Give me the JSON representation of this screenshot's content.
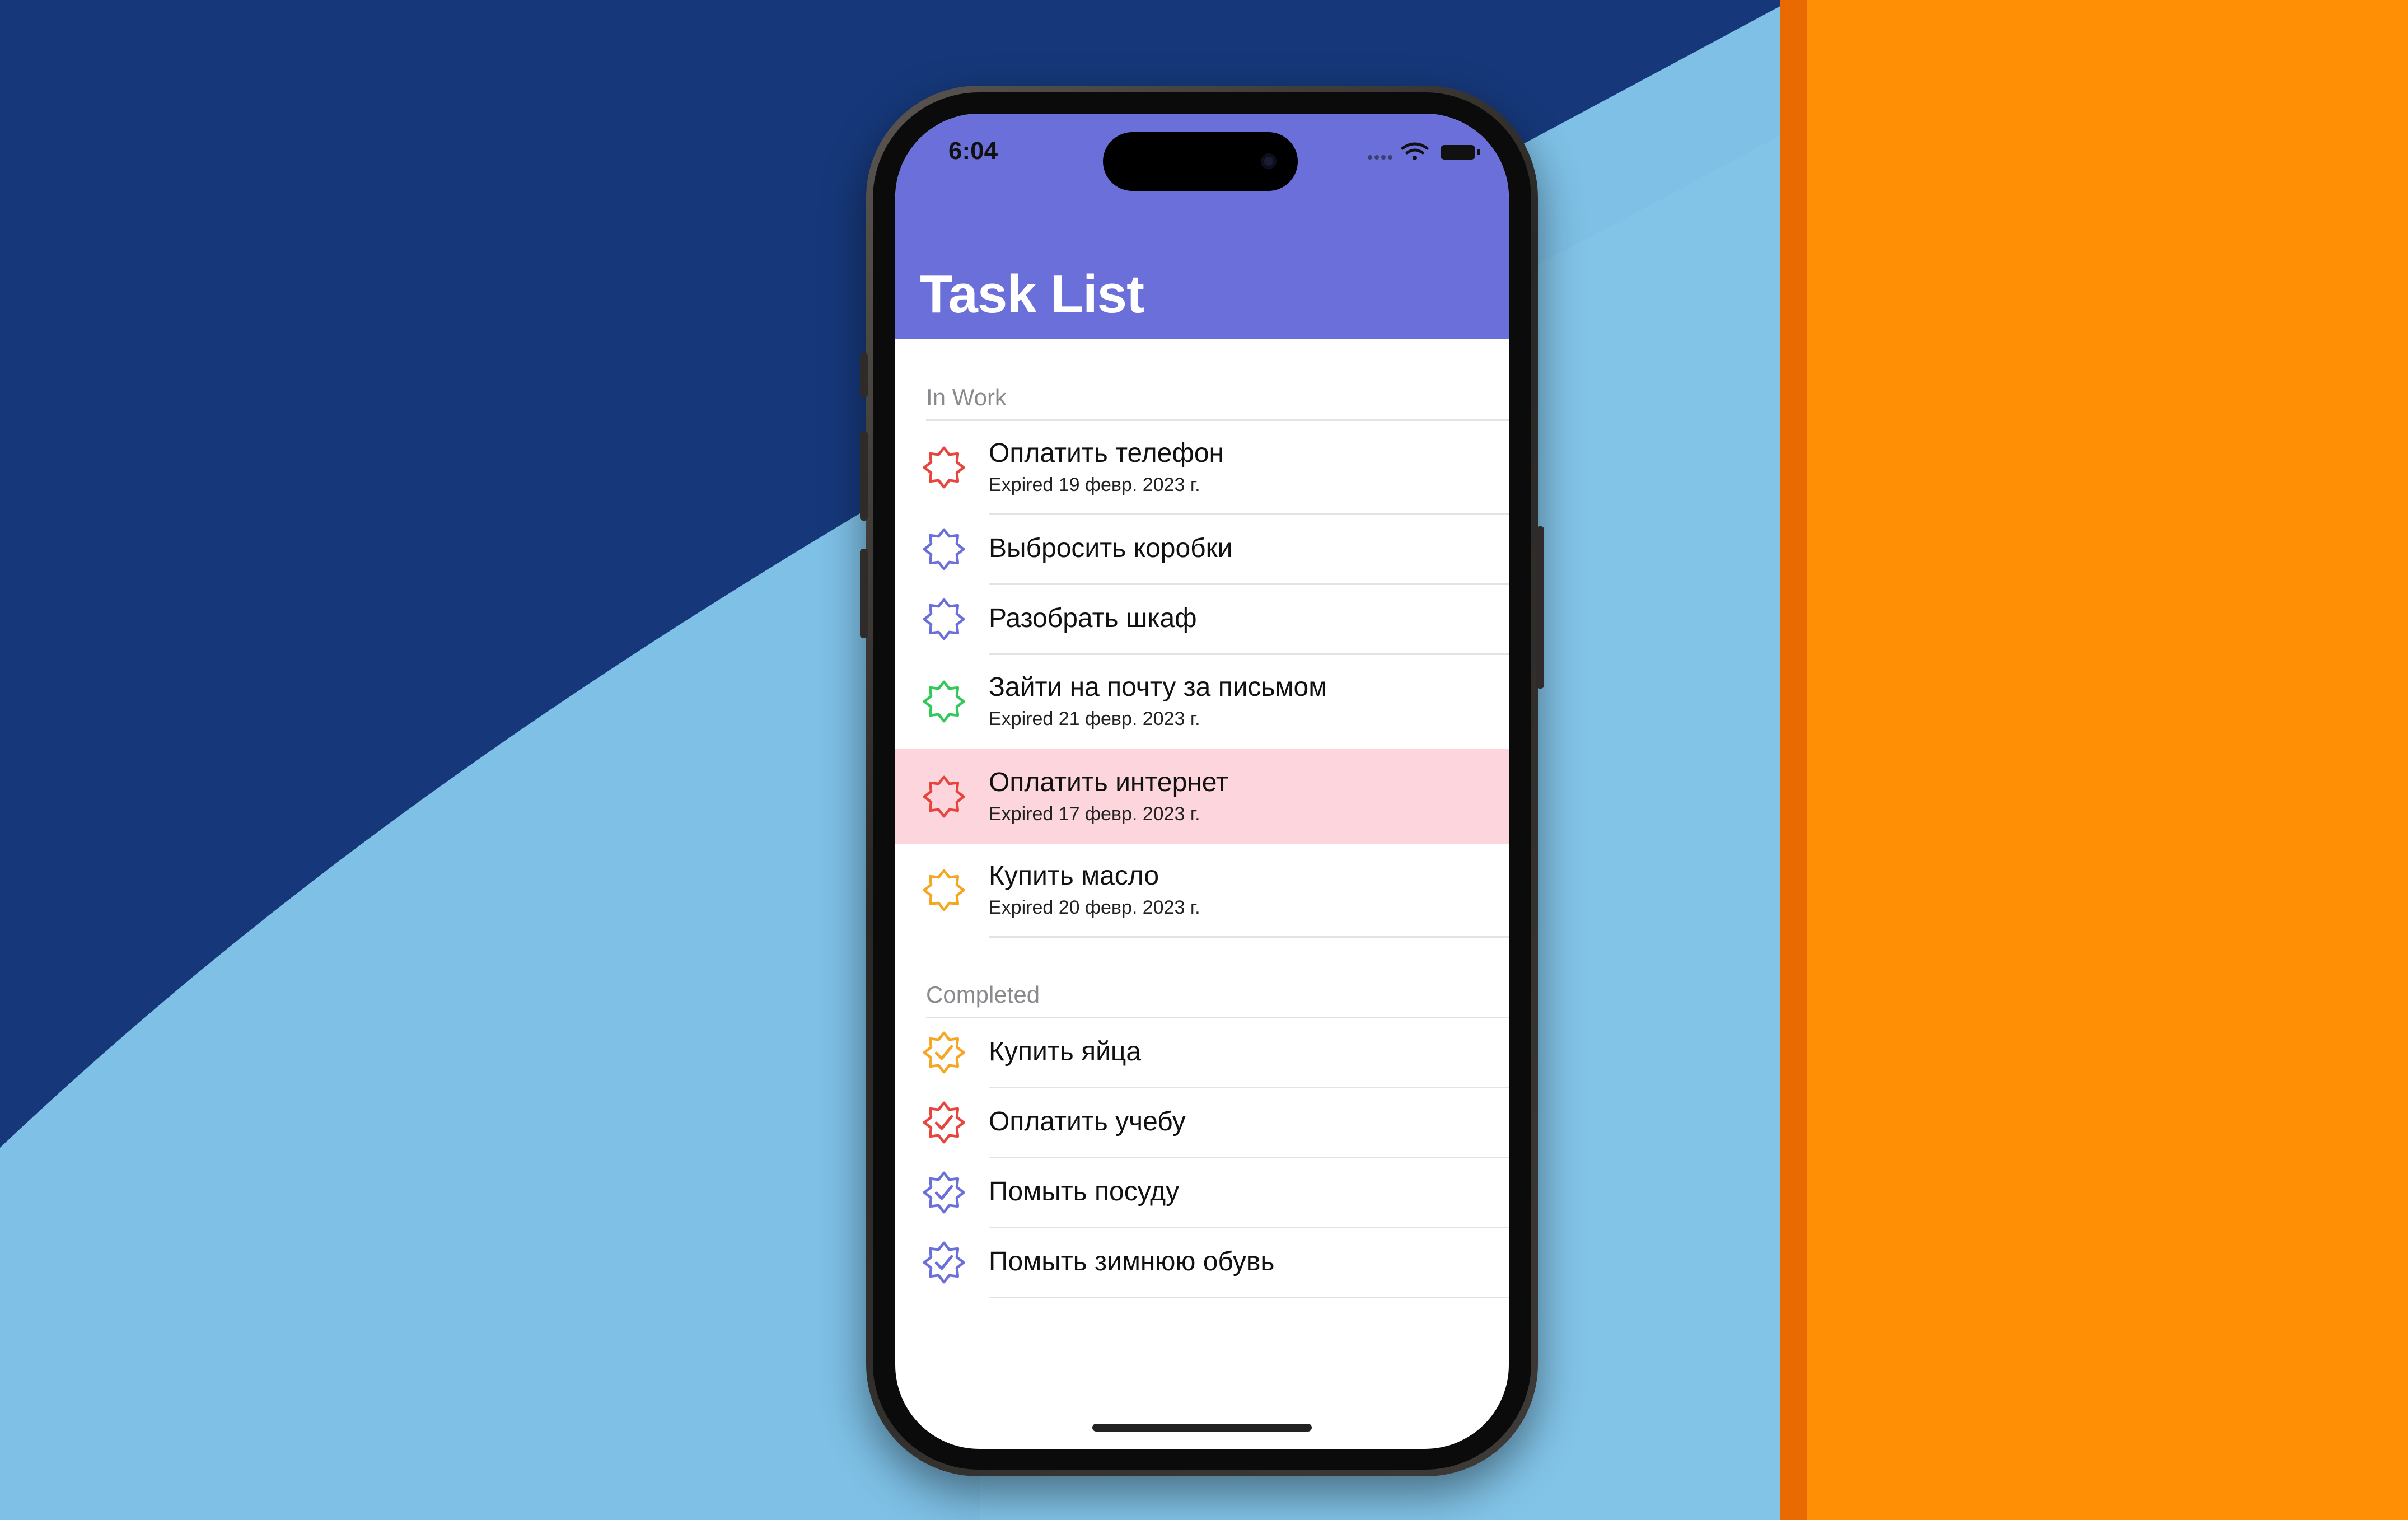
{
  "status_bar": {
    "time": "6:04"
  },
  "nav": {
    "title": "Task List"
  },
  "colors": {
    "accent": "#6a6fd9",
    "red": "#e5453d",
    "blue": "#6a6fd9",
    "green": "#34c759",
    "orange": "#f5a623",
    "highlight": "#fcd6dc"
  },
  "sections": {
    "in_work": {
      "header": "In Work",
      "tasks": [
        {
          "title": "Оплатить телефон",
          "subtitle": "Expired 19 февр. 2023 г.",
          "color": "red",
          "icon": "badge-outline-icon"
        },
        {
          "title": "Выбросить коробки",
          "subtitle": "",
          "color": "blue",
          "icon": "badge-outline-icon"
        },
        {
          "title": "Разобрать шкаф",
          "subtitle": "",
          "color": "blue",
          "icon": "badge-outline-icon"
        },
        {
          "title": "Зайти на почту за письмом",
          "subtitle": "Expired 21 февр. 2023 г.",
          "color": "green",
          "icon": "badge-outline-icon"
        },
        {
          "title": "Оплатить интернет",
          "subtitle": "Expired 17 февр. 2023 г.",
          "color": "red",
          "icon": "badge-outline-icon",
          "highlighted": true
        },
        {
          "title": "Купить масло",
          "subtitle": "Expired 20 февр. 2023 г.",
          "color": "orange",
          "icon": "badge-outline-icon"
        }
      ]
    },
    "completed": {
      "header": "Completed",
      "tasks": [
        {
          "title": "Купить яйца",
          "color": "orange",
          "icon": "checkmark-badge-icon"
        },
        {
          "title": "Оплатить учебу",
          "color": "red",
          "icon": "checkmark-badge-icon"
        },
        {
          "title": "Помыть посуду",
          "color": "blue",
          "icon": "checkmark-badge-icon"
        },
        {
          "title": "Помыть зимнюю обувь",
          "color": "blue",
          "icon": "checkmark-badge-icon"
        }
      ]
    }
  }
}
